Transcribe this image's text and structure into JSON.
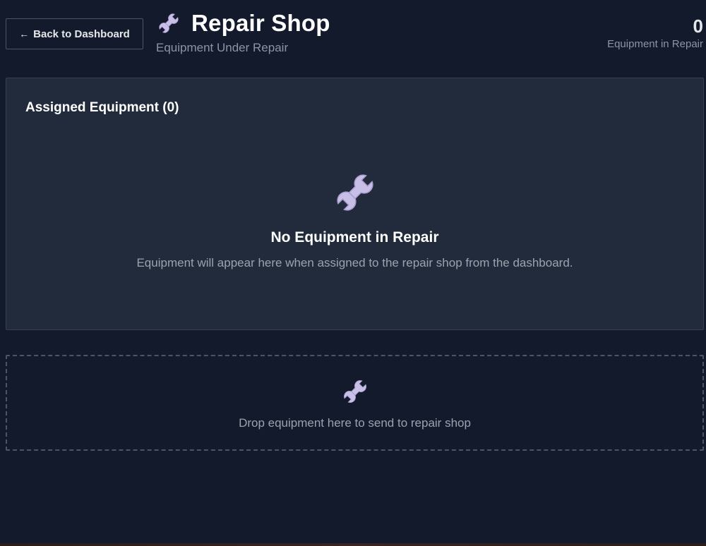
{
  "header": {
    "back_label": "Back to Dashboard",
    "title": "Repair Shop",
    "subtitle": "Equipment Under Repair",
    "title_icon": "wrench-icon"
  },
  "counter": {
    "value": "0",
    "label": "Equipment in Repair"
  },
  "assigned": {
    "title": "Assigned Equipment (0)",
    "empty_icon": "wrench-icon",
    "empty_title": "No Equipment in Repair",
    "empty_text": "Equipment will appear here when assigned to the repair shop from the dashboard."
  },
  "dropzone": {
    "icon": "wrench-icon",
    "text": "Drop equipment here to send to repair shop"
  },
  "colors": {
    "background": "#121a2b",
    "panel": "#222b3b",
    "icon": "#c8bfe7"
  }
}
